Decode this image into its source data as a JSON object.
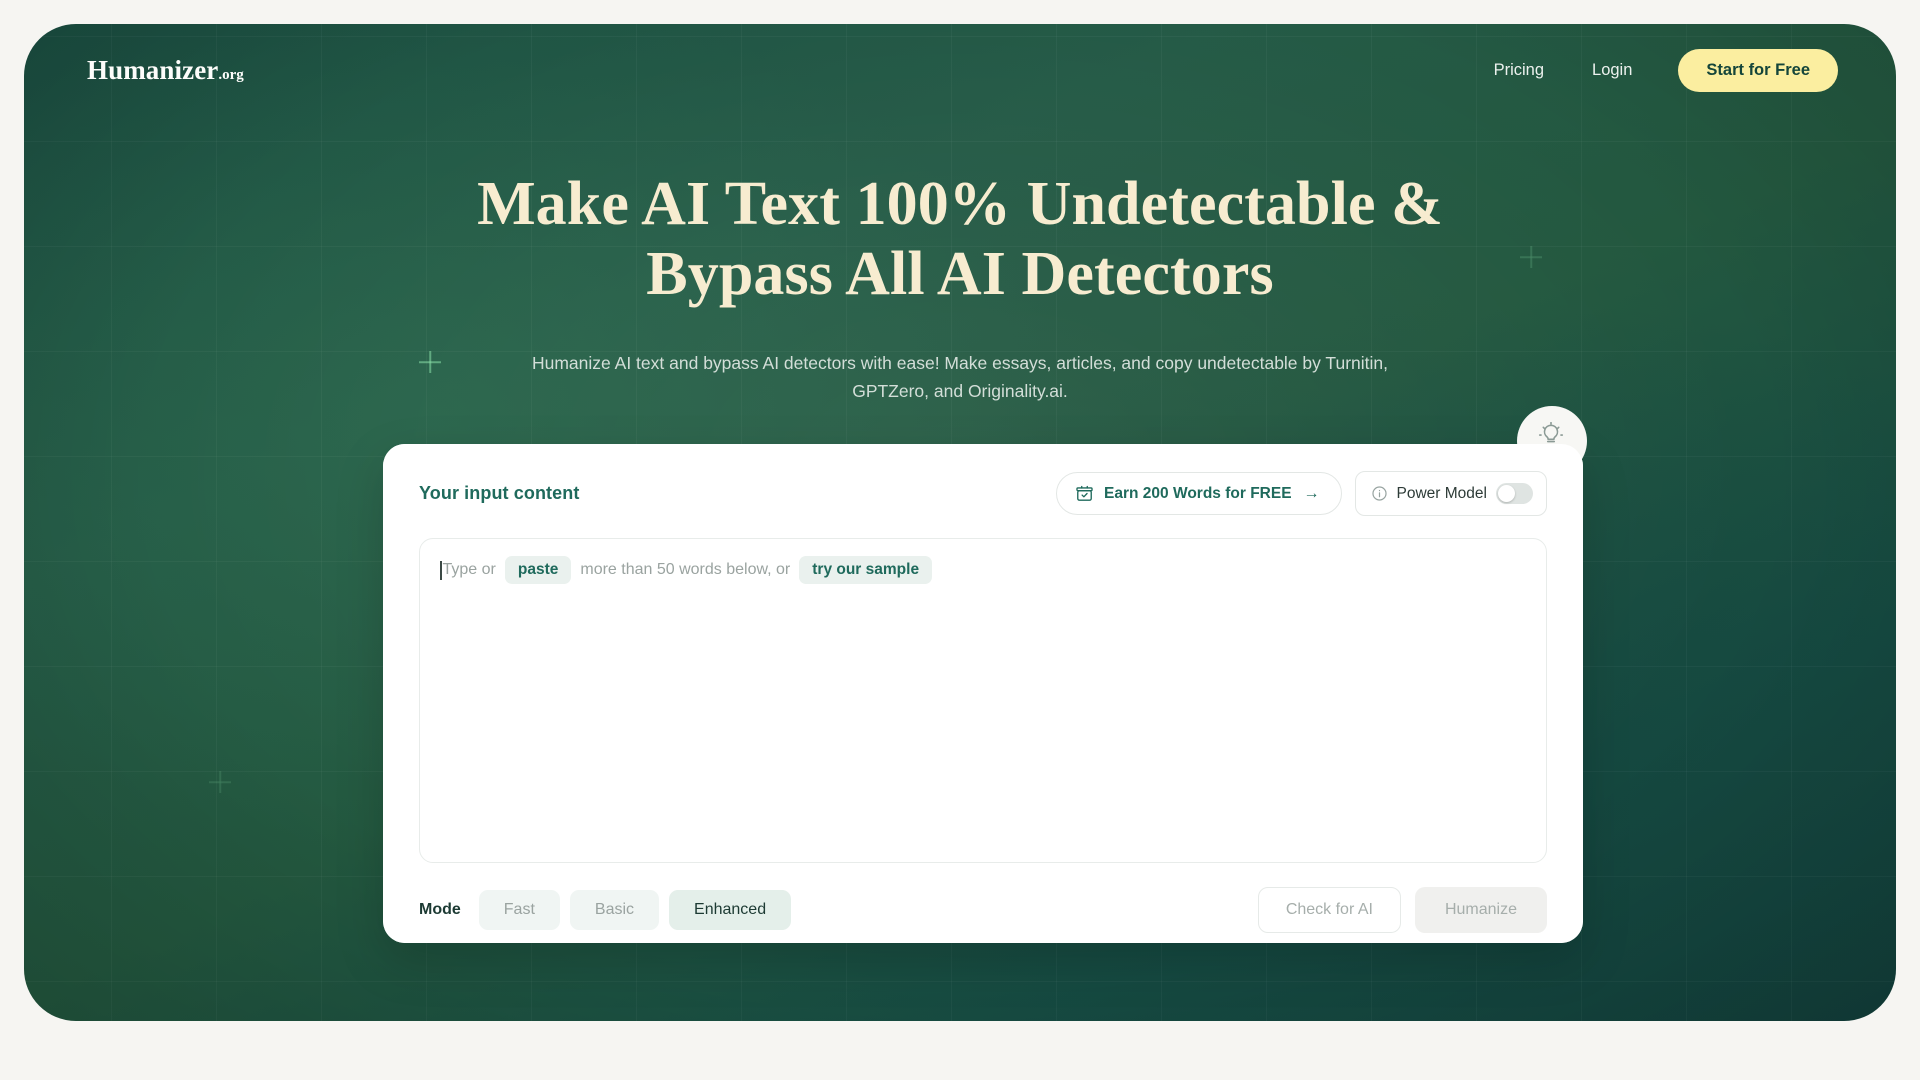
{
  "colors": {
    "page_bg": "#f6f5f2",
    "hero_green_dark": "#123f3c",
    "hero_green_mid": "#245a46",
    "headline_cream": "#f7ecd0",
    "cta_yellow": "#fbeea0",
    "teal_accent": "#1f6a5c"
  },
  "nav": {
    "logo_name": "Humanizer",
    "logo_tld": ".org",
    "links": [
      {
        "label": "Pricing"
      },
      {
        "label": "Login"
      }
    ],
    "cta_label": "Start for Free"
  },
  "hero": {
    "headline_line1": "Make AI Text 100% Undetectable &",
    "headline_line2": "Bypass All AI Detectors",
    "subhead": "Humanize AI text and bypass AI detectors with ease! Make essays, articles, and copy undetectable by Turnitin, GPTZero, and Originality.ai."
  },
  "card": {
    "title": "Your input content",
    "earn_button": {
      "icon": "gift-box-icon",
      "label": "Earn 200 Words for FREE",
      "arrow": "→"
    },
    "power_model": {
      "icon": "info-circle-icon",
      "label": "Power Model",
      "toggle_state": "off"
    },
    "bulb_icon": "lightbulb-icon",
    "input": {
      "placeholder_prefix": "Type or",
      "placeholder_chip_paste": "paste",
      "placeholder_middle": "more than 50 words below, or",
      "placeholder_chip_sample": "try our sample",
      "value": ""
    },
    "mode": {
      "label": "Mode",
      "options": [
        {
          "label": "Fast",
          "selected": false
        },
        {
          "label": "Basic",
          "selected": false
        },
        {
          "label": "Enhanced",
          "selected": true
        }
      ]
    },
    "actions": {
      "check_label": "Check for AI",
      "humanize_label": "Humanize"
    }
  }
}
